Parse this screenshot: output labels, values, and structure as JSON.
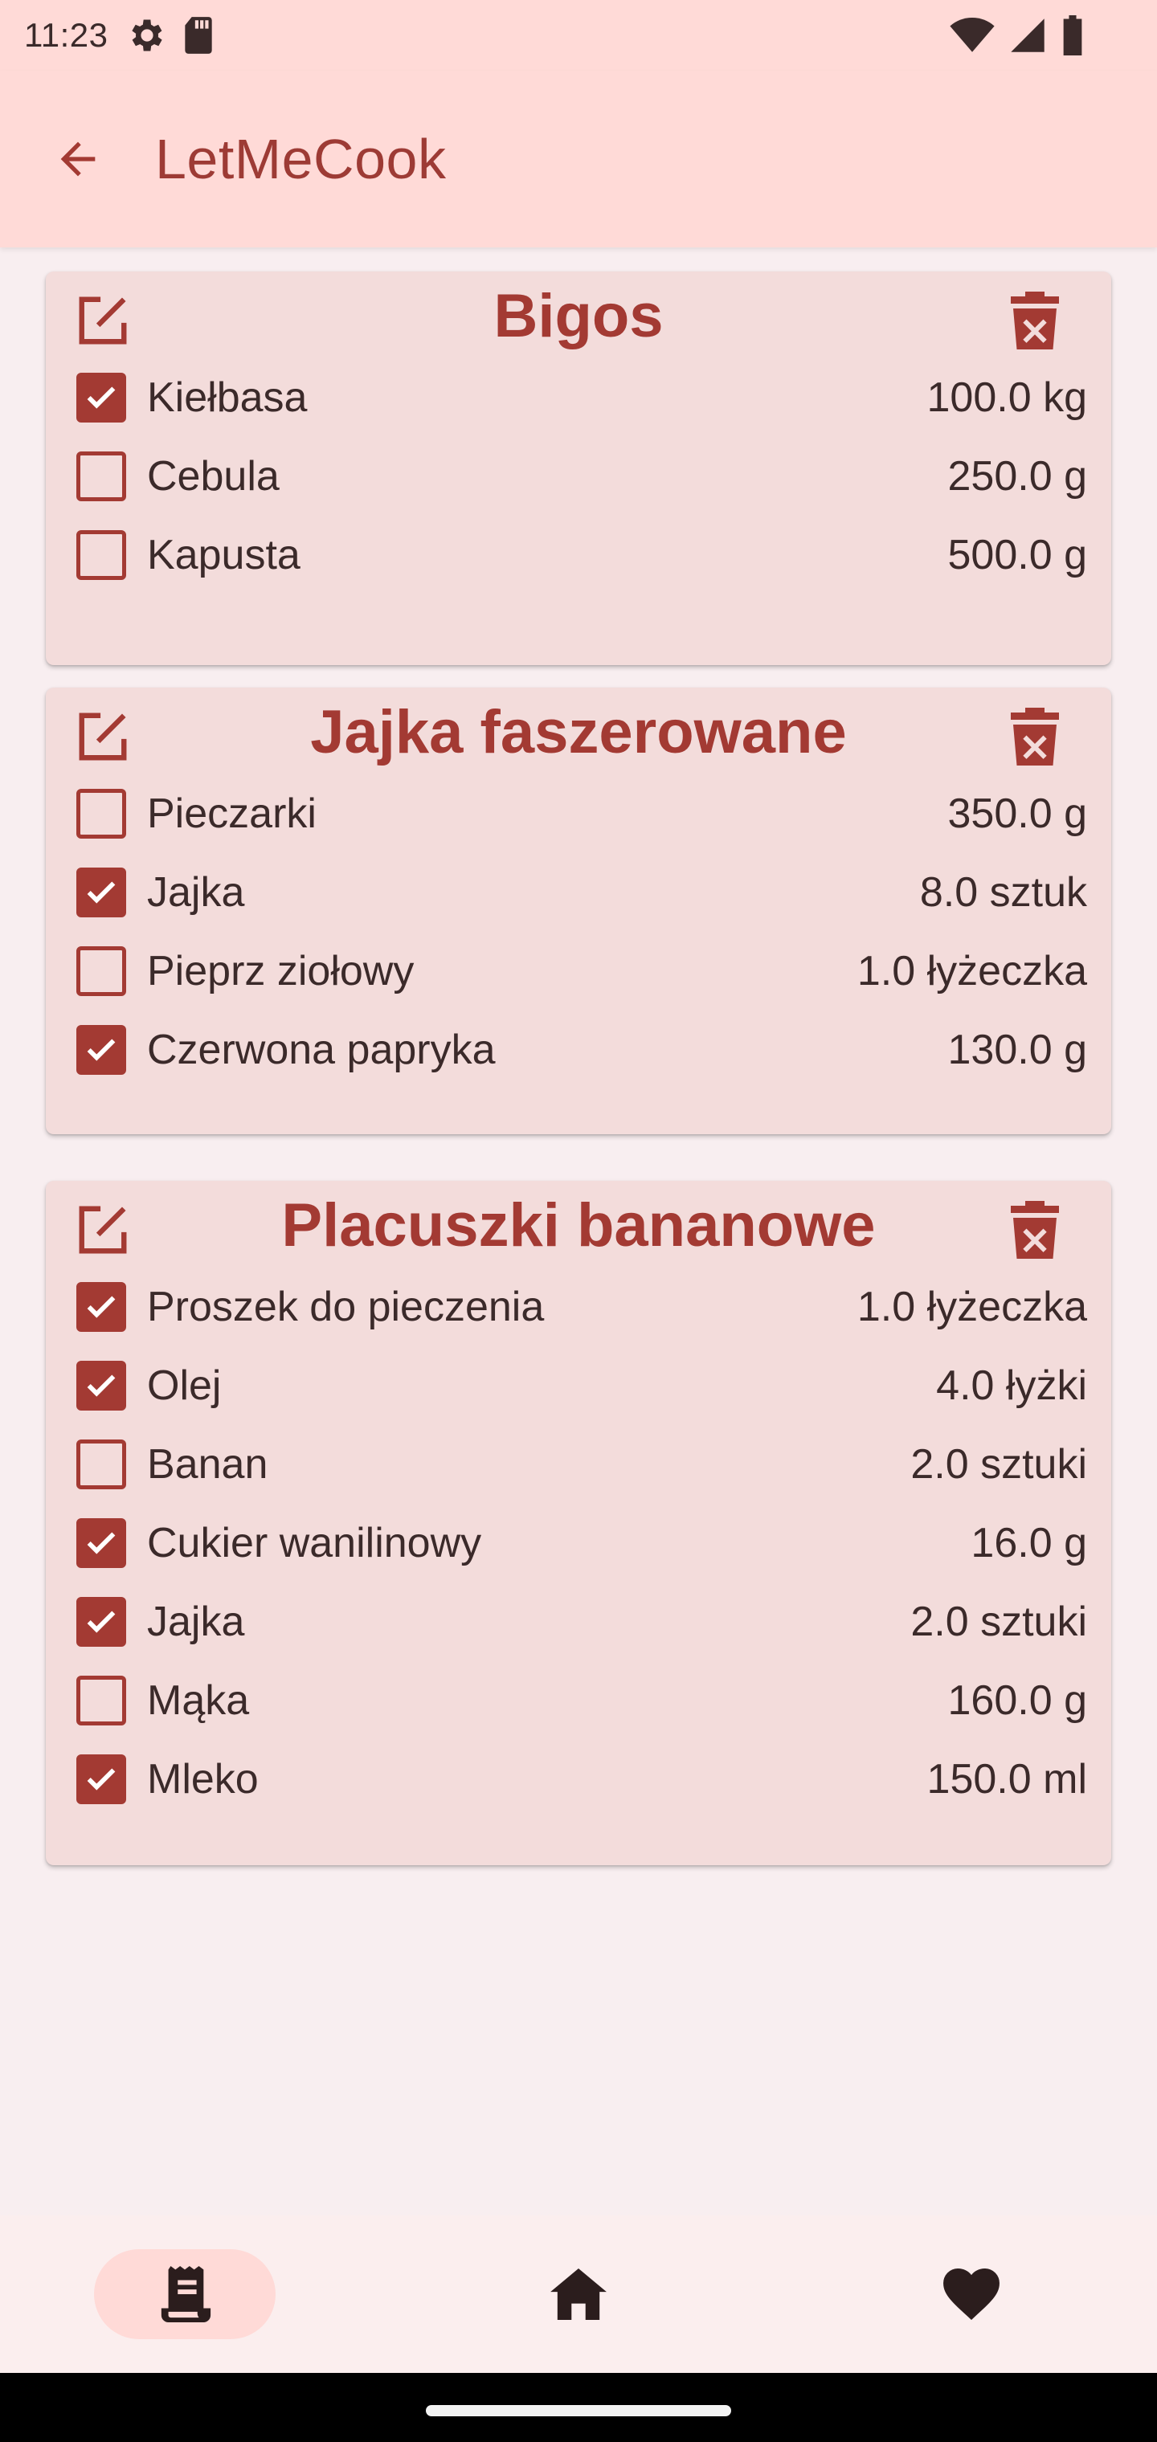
{
  "status_bar": {
    "time": "11:23"
  },
  "app_bar": {
    "title": "LetMeCook",
    "back_icon": "arrow-back-icon"
  },
  "colors": {
    "accent": "#a33a33",
    "app_bar_bg": "#ffdad7",
    "card_bg": "#f3dcdb",
    "page_bg": "#f8eef0"
  },
  "recipes": [
    {
      "title": "Bigos",
      "ingredients": [
        {
          "name": "Kiełbasa",
          "quantity": "100.0 kg",
          "checked": true
        },
        {
          "name": "Cebula",
          "quantity": "250.0 g",
          "checked": false
        },
        {
          "name": "Kapusta",
          "quantity": "500.0 g",
          "checked": false
        }
      ]
    },
    {
      "title": "Jajka faszerowane",
      "ingredients": [
        {
          "name": "Pieczarki",
          "quantity": "350.0 g",
          "checked": false
        },
        {
          "name": "Jajka",
          "quantity": "8.0 sztuk",
          "checked": true
        },
        {
          "name": "Pieprz ziołowy",
          "quantity": "1.0 łyżeczka",
          "checked": false
        },
        {
          "name": "Czerwona papryka",
          "quantity": "130.0 g",
          "checked": true
        }
      ]
    },
    {
      "title": "Placuszki bananowe",
      "ingredients": [
        {
          "name": "Proszek do pieczenia",
          "quantity": "1.0 łyżeczka",
          "checked": true
        },
        {
          "name": "Olej",
          "quantity": "4.0 łyżki",
          "checked": true
        },
        {
          "name": "Banan",
          "quantity": "2.0 sztuki",
          "checked": false
        },
        {
          "name": "Cukier wanilinowy",
          "quantity": "16.0 g",
          "checked": true
        },
        {
          "name": "Jajka",
          "quantity": "2.0 sztuki",
          "checked": true
        },
        {
          "name": "Mąka",
          "quantity": "160.0 g",
          "checked": false
        },
        {
          "name": "Mleko",
          "quantity": "150.0 ml",
          "checked": true
        }
      ]
    }
  ],
  "bottom_nav": {
    "items": [
      {
        "icon": "receipt-icon",
        "active": true
      },
      {
        "icon": "home-icon",
        "active": false
      },
      {
        "icon": "heart-icon",
        "active": false
      }
    ]
  }
}
